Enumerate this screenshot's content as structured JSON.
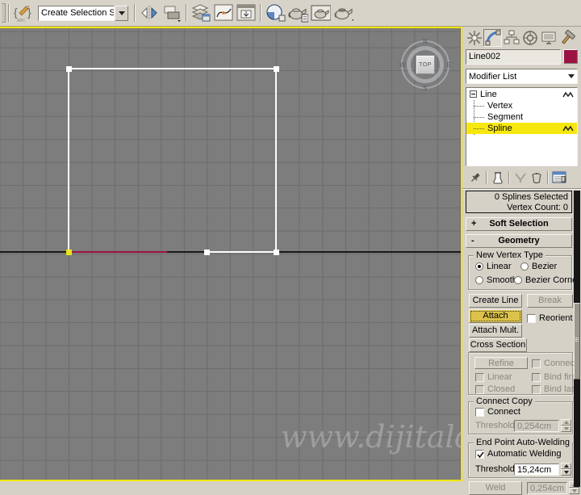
{
  "colors": {
    "viewport_bg": "#7d7d7d",
    "grid_line": "#6c6c6c",
    "axis_line": "#181818",
    "spline_color": "#ffffff",
    "first_vertex_color": "#ece41a",
    "object_color_swatch": "#9c1343",
    "red_segment": "#9d1240",
    "active_viewport_border": "#f2e500",
    "stack_highlight": "#f6e80e",
    "active_button": "#dcc24b",
    "ui_gray": "#d5d1c7"
  },
  "toolbar": {
    "selection_sets_value": "Create Selection Se",
    "icons": [
      "named-selection-sets",
      "mirror",
      "align",
      "layer-manager",
      "curve-editor",
      "schematic-view",
      "material-editor",
      "render-setup",
      "rendered-frame-window",
      "quick-render"
    ]
  },
  "viewport": {
    "viewcube_label": "TOP",
    "compass": {
      "n": "N",
      "e": "E",
      "s": "S",
      "w": "W"
    },
    "watermark": "www.dijitalde"
  },
  "panel": {
    "tabs": [
      "create",
      "modify",
      "hierarchy",
      "motion",
      "display",
      "utilities"
    ],
    "object_name": "Line002",
    "modifier_list": "Modifier List",
    "stack_items": [
      {
        "label": "Line"
      },
      {
        "label": "Vertex"
      },
      {
        "label": "Segment"
      },
      {
        "label": "Spline"
      }
    ],
    "selection_info_line1": "0 Splines Selected",
    "selection_info_line2": "Vertex Count: 0",
    "soft_selection": {
      "state": "+",
      "title": "Soft Selection"
    },
    "geometry": {
      "state": "-",
      "title": "Geometry"
    },
    "new_vertex_type": {
      "title": "New Vertex Type",
      "options": [
        "Linear",
        "Bezier",
        "Smooth",
        "Bezier Corner"
      ],
      "selected": "Linear"
    },
    "buttons": {
      "create_line": "Create Line",
      "break": "Break",
      "attach": "Attach",
      "attach_mult": "Attach Mult.",
      "cross_section": "Cross Section",
      "refine": "Refine",
      "weld": "Weld"
    },
    "checkboxes": {
      "reorient": "Reorient",
      "connect_refine": "Connect",
      "linear": "Linear",
      "bind_first": "Bind first",
      "closed": "Closed",
      "bind_last": "Bind last",
      "connect_copy": "Connect",
      "automatic_welding": "Automatic Welding"
    },
    "connect_copy": {
      "title": "Connect Copy",
      "threshold_label": "Threshold",
      "threshold_value": "0,254cm"
    },
    "end_point_auto_welding": {
      "title": "End Point Auto-Welding",
      "threshold_label": "Threshold",
      "threshold_value": "15,24cm"
    },
    "weld_threshold_value": "0,254cm"
  }
}
